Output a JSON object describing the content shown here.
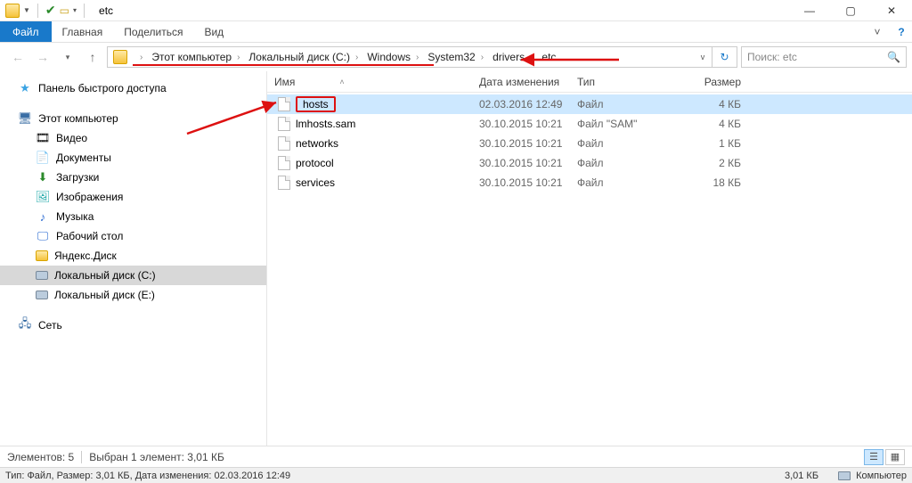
{
  "window": {
    "title": "etc"
  },
  "ribbon": {
    "file": "Файл",
    "tabs": [
      "Главная",
      "Поделиться",
      "Вид"
    ]
  },
  "breadcrumb": [
    "Этот компьютер",
    "Локальный диск (C:)",
    "Windows",
    "System32",
    "drivers",
    "etc"
  ],
  "search": {
    "placeholder": "Поиск: etc"
  },
  "sidebar": {
    "quick": "Панель быстрого доступа",
    "thispc": "Этот компьютер",
    "items": [
      {
        "label": "Видео",
        "icon": "video"
      },
      {
        "label": "Документы",
        "icon": "doc"
      },
      {
        "label": "Загрузки",
        "icon": "download"
      },
      {
        "label": "Изображения",
        "icon": "images"
      },
      {
        "label": "Музыка",
        "icon": "music"
      },
      {
        "label": "Рабочий стол",
        "icon": "desktop"
      },
      {
        "label": "Яндекс.Диск",
        "icon": "yadisk"
      },
      {
        "label": "Локальный диск (C:)",
        "icon": "disk",
        "selected": true
      },
      {
        "label": "Локальный диск (E:)",
        "icon": "disk"
      }
    ],
    "network": "Сеть"
  },
  "columns": {
    "name": "Имя",
    "date": "Дата изменения",
    "type": "Тип",
    "size": "Размер"
  },
  "files": [
    {
      "name": "hosts",
      "date": "02.03.2016 12:49",
      "type": "Файл",
      "size": "4 КБ",
      "selected": true
    },
    {
      "name": "lmhosts.sam",
      "date": "30.10.2015 10:21",
      "type": "Файл \"SAM\"",
      "size": "4 КБ"
    },
    {
      "name": "networks",
      "date": "30.10.2015 10:21",
      "type": "Файл",
      "size": "1 КБ"
    },
    {
      "name": "protocol",
      "date": "30.10.2015 10:21",
      "type": "Файл",
      "size": "2 КБ"
    },
    {
      "name": "services",
      "date": "30.10.2015 10:21",
      "type": "Файл",
      "size": "18 КБ"
    }
  ],
  "status1": {
    "count": "Элементов: 5",
    "selection": "Выбран 1 элемент: 3,01 КБ"
  },
  "status2": {
    "left": "Тип: Файл, Размер: 3,01 КБ, Дата изменения: 02.03.2016 12:49",
    "size": "3,01 КБ",
    "location": "Компьютер"
  }
}
